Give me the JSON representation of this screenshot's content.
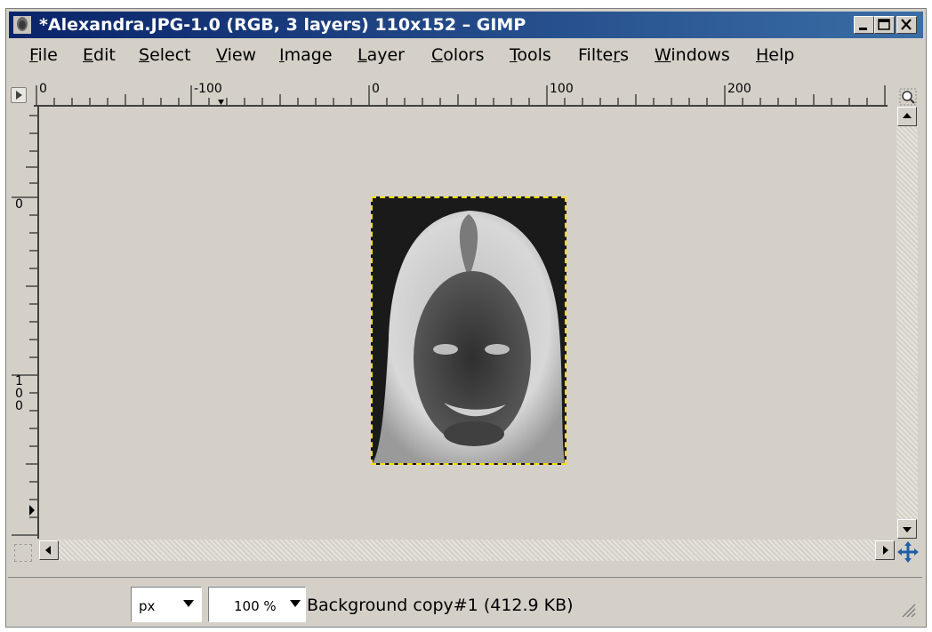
{
  "window": {
    "title": "*Alexandra.JPG-1.0 (RGB, 3 layers) 110x152 – GIMP",
    "minimize_icon": "minimize-icon",
    "maximize_icon": "maximize-icon",
    "close_icon": "close-icon"
  },
  "menu": {
    "items": [
      {
        "first": "F",
        "rest": "ile"
      },
      {
        "first": "E",
        "rest": "dit"
      },
      {
        "first": "S",
        "rest": "elect"
      },
      {
        "first": "V",
        "rest": "iew"
      },
      {
        "first": "I",
        "rest": "mage"
      },
      {
        "first": "L",
        "rest": "ayer"
      },
      {
        "first": "C",
        "rest": "olors"
      },
      {
        "first": "T",
        "rest": "ools"
      },
      {
        "pre": "Filte",
        "first": "r",
        "rest": "s"
      },
      {
        "first": "W",
        "rest": "indows"
      },
      {
        "first": "H",
        "rest": "elp"
      }
    ]
  },
  "rulers": {
    "horizontal_labels": [
      "0",
      "-100",
      "0",
      "100",
      "200"
    ],
    "vertical_labels": [
      "0",
      "1",
      "0",
      "0"
    ]
  },
  "canvas": {
    "image_description": "inverted portrait photo"
  },
  "statusbar": {
    "unit": "px",
    "zoom": "100 %",
    "layer_info": "Background copy#1 (412.9 KB)"
  },
  "colors": {
    "titlebar_start": "#0a246a",
    "titlebar_end": "#3a6ea5",
    "selection_border": "#f5e000",
    "window_bg": "#d4d0c8"
  }
}
